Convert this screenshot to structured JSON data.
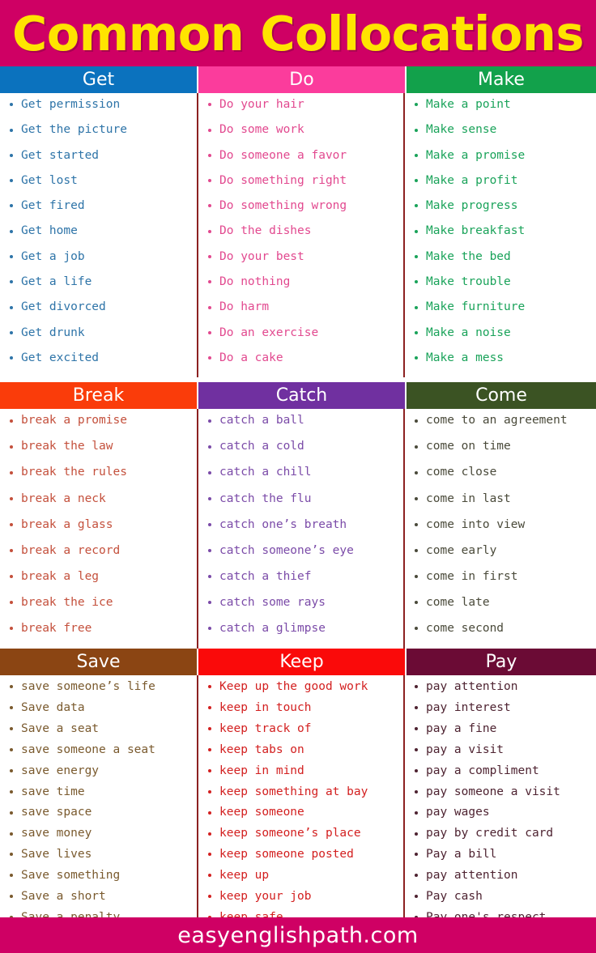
{
  "title": "Common Collocations",
  "footer": "easyenglishpath.com",
  "colors": {
    "title_bg": "#cf0064",
    "title_text": "#ffe400",
    "footer_bg": "#cf0064",
    "footer_text": "#ffffff",
    "divider": "#8c2121",
    "page_bg": "#ffffff"
  },
  "sections": [
    {
      "columns": [
        {
          "header": "Get",
          "header_bg": "#0b72be",
          "header_text": "#ffffff",
          "text_color": "#2e74a8",
          "bullet_color": "#2e74a8",
          "items": [
            "Get permission",
            "Get the picture",
            "Get started",
            "Get lost",
            "Get fired",
            "Get home",
            "Get a job",
            "Get a life",
            "Get divorced",
            "Get drunk",
            "Get excited"
          ]
        },
        {
          "header": "Do",
          "header_bg": "#fb3c9c",
          "header_text": "#ffffff",
          "text_color": "#e2498f",
          "bullet_color": "#e2498f",
          "items": [
            "Do your hair",
            "Do some work",
            "Do someone a favor",
            "Do something right",
            "Do something wrong",
            "Do the dishes",
            "Do your best",
            "Do nothing",
            "Do harm",
            "Do an exercise",
            "Do a cake"
          ]
        },
        {
          "header": "Make",
          "header_bg": "#12a14b",
          "header_text": "#ffffff",
          "text_color": "#1aa35a",
          "bullet_color": "#1aa35a",
          "items": [
            "Make a point",
            "Make sense",
            "Make a promise",
            "Make a profit",
            "Make progress",
            "Make breakfast",
            "Make the bed",
            "Make trouble",
            "Make furniture",
            "Make a noise",
            "Make a mess"
          ]
        }
      ]
    },
    {
      "columns": [
        {
          "header": "Break",
          "header_bg": "#fa3c0a",
          "header_text": "#ffffff",
          "text_color": "#c4503c",
          "bullet_color": "#c4503c",
          "items": [
            "break a promise",
            "break the law",
            "break the rules",
            "break a neck",
            "break a glass",
            "break a record",
            "break a leg",
            "break the ice",
            "break free"
          ]
        },
        {
          "header": "Catch",
          "header_bg": "#7030a0",
          "header_text": "#ffffff",
          "text_color": "#7b4ba8",
          "bullet_color": "#7b4ba8",
          "items": [
            "catch a ball",
            "catch a cold",
            "catch a chill",
            "catch the flu",
            "catch one’s breath",
            "catch someone’s eye",
            "catch a thief",
            "catch some rays",
            "catch a glimpse"
          ]
        },
        {
          "header": "Come",
          "header_bg": "#3b5323",
          "header_text": "#ffffff",
          "text_color": "#4a4a3a",
          "bullet_color": "#4a4a3a",
          "items": [
            "come to an agreement",
            "come on time",
            "come close",
            "come in last",
            "come into view",
            "come early",
            "come in first",
            "come late",
            "come second"
          ]
        }
      ]
    },
    {
      "columns": [
        {
          "header": "Save",
          "header_bg": "#8b4513",
          "header_text": "#ffffff",
          "text_color": "#7a5a2e",
          "bullet_color": "#7a5a2e",
          "items": [
            "save someone’s life",
            "Save data",
            "Save a seat",
            "save someone a seat",
            "save energy",
            "save time",
            "save space",
            "save money",
            "Save lives",
            "Save something",
            "Save a short",
            "Save a penalty"
          ]
        },
        {
          "header": "Keep",
          "header_bg": "#fa0a0a",
          "header_text": "#ffffff",
          "text_color": "#d32020",
          "bullet_color": "#d32020",
          "items": [
            "Keep up the good work",
            "keep in touch",
            "keep track of",
            "keep tabs on",
            "keep in mind",
            "keep something at bay",
            "keep someone",
            "keep someone’s place",
            "keep someone posted",
            "keep up",
            "keep your job",
            "keep safe"
          ]
        },
        {
          "header": "Pay",
          "header_bg": "#6b0b35",
          "header_text": "#ffffff",
          "text_color": "#4e2331",
          "bullet_color": "#4e2331",
          "items": [
            "pay attention",
            "pay interest",
            "pay a fine",
            "pay a visit",
            "pay a compliment",
            "pay someone a visit",
            "pay wages",
            "pay by credit card",
            "Pay a bill",
            "pay attention",
            "Pay cash",
            "Pay one's respect"
          ]
        }
      ]
    }
  ]
}
